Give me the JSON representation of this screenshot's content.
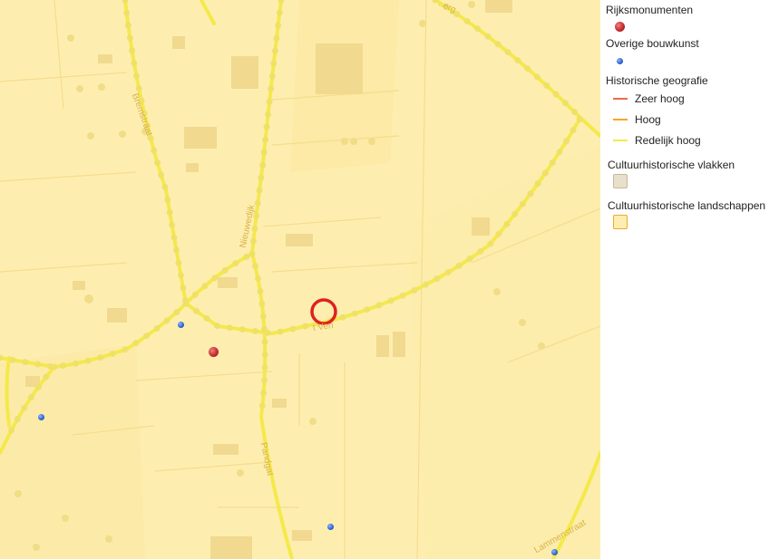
{
  "map": {
    "streets": [
      {
        "id": "bremstraat",
        "name": "Bremstraat"
      },
      {
        "id": "nieuwedijk",
        "name": "Nieuwedijk"
      },
      {
        "id": "pandgat",
        "name": "Pandgat"
      },
      {
        "id": "t-ven",
        "name": "t Ven"
      },
      {
        "id": "top-right",
        "name": "..erg"
      },
      {
        "id": "bottom-right",
        "name": "Lammenstraat"
      }
    ],
    "markers": [
      {
        "type": "rijksmonument",
        "color": "#c0282a"
      },
      {
        "type": "overige-bouwkunst",
        "color": "#2a62d0"
      }
    ],
    "selection_color": "#e02020"
  },
  "legend": {
    "rijksmonumenten": {
      "label": "Rijksmonumenten",
      "color": "#c0282a"
    },
    "overige_bouwkunst": {
      "label": "Overige bouwkunst",
      "color": "#2a62d0"
    },
    "historische_geografie": {
      "label": "Historische geografie",
      "items": [
        {
          "label": "Zeer hoog",
          "color": "#ef6a4a"
        },
        {
          "label": "Hoog",
          "color": "#f5a623"
        },
        {
          "label": "Redelijk hoog",
          "color": "#f5e94a"
        }
      ]
    },
    "cultuurhistorische_vlakken": {
      "label": "Cultuurhistorische vlakken",
      "fill": "#e8dfcd",
      "border": "#c9b89a"
    },
    "cultuurhistorische_landschappen": {
      "label": "Cultuurhistorische landschappen",
      "fill": "#fdeeb0",
      "border": "#f0a830"
    }
  }
}
